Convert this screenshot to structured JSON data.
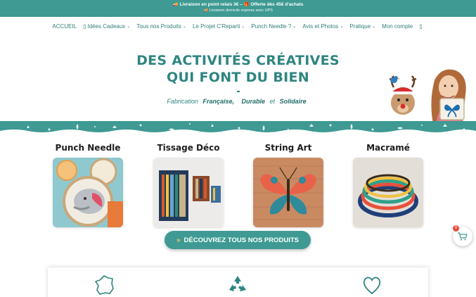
{
  "promo": {
    "line1": "🚚 Livraison en point relais 3€  – 🎁 Offerte  dès 45€ d'achats",
    "line2": "🚚 Livraison domicile express avec UPS"
  },
  "nav": {
    "items": [
      {
        "label": "ACCUEIL",
        "dropdown": false
      },
      {
        "label": "Idées Cadeaux",
        "dropdown": true,
        "icon": "gift-icon"
      },
      {
        "label": "Tous nos Produits",
        "dropdown": true
      },
      {
        "label": "Le Projet C'Reparti",
        "dropdown": true
      },
      {
        "label": "Punch Needle ?",
        "dropdown": true
      },
      {
        "label": "Avis et Photos",
        "dropdown": true
      },
      {
        "label": "Pratique",
        "dropdown": true
      },
      {
        "label": "Mon compte",
        "dropdown": false
      }
    ],
    "search_icon": "search-icon"
  },
  "hero": {
    "title_line1": "DES ACTIVITÉS CRÉATIVES",
    "title_line2": "QUI FONT DU BIEN",
    "sub_prefix": "Fabrication",
    "sub_w1": "Française,",
    "sub_w2": "Durable",
    "sub_and": "et",
    "sub_w3": "Solidaire"
  },
  "categories": [
    {
      "title": "Punch Needle"
    },
    {
      "title": "Tissage Déco"
    },
    {
      "title": "String Art"
    },
    {
      "title": "Macramé"
    }
  ],
  "cta": {
    "label": "DÉCOUVREZ TOUS NOS PRODUITS"
  },
  "cart": {
    "count": "0"
  },
  "values": {
    "icons": [
      "france-map-icon",
      "recycle-icon",
      "heart-icon"
    ]
  },
  "colors": {
    "brand_teal": "#3e9a93",
    "title_teal": "#2f8580",
    "accent_gold": "#f0c36b"
  }
}
